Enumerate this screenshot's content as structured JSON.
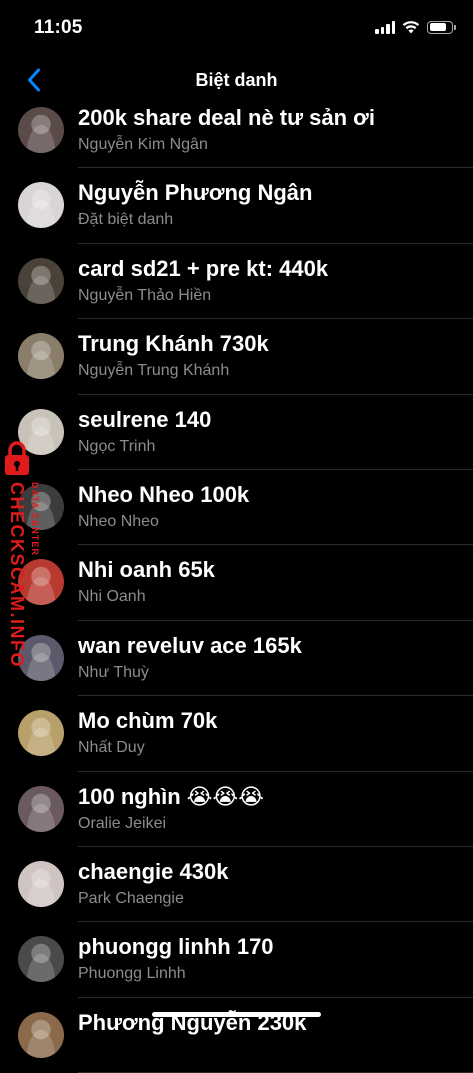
{
  "status_bar": {
    "time": "11:05",
    "battery_level": 0.8
  },
  "nav": {
    "title": "Biệt danh",
    "back_icon": "chevron-left-icon",
    "accent": "#0a84ff"
  },
  "watermark": {
    "main": "CHECKSCAM.INFO",
    "sub": "DATA CENTER",
    "color": "#e01b1b"
  },
  "contacts": [
    {
      "nickname": "200k share deal nè tư sản ơi",
      "name": "Nguyễn Kim Ngân",
      "avatar_color": "#5a4a48"
    },
    {
      "nickname": "Nguyễn Phương Ngân",
      "name": "Đặt biệt danh",
      "avatar_color": "#d9d4d6"
    },
    {
      "nickname": "card sd21 + pre kt: 440k",
      "name": "Nguyễn Thảo Hiền",
      "avatar_color": "#4a4238"
    },
    {
      "nickname": "Trung Khánh 730k",
      "name": "Nguyễn Trung Khánh",
      "avatar_color": "#8a7e6a"
    },
    {
      "nickname": "seulrene 140",
      "name": "Ngọc Trinh",
      "avatar_color": "#c9c2b8"
    },
    {
      "nickname": "Nheo Nheo 100k",
      "name": "Nheo Nheo",
      "avatar_color": "#3c3c3c"
    },
    {
      "nickname": "Nhi oanh 65k",
      "name": "Nhi Oanh",
      "avatar_color": "#b83a2e"
    },
    {
      "nickname": "wan reveluv ace 165k",
      "name": "Như Thuỳ",
      "avatar_color": "#5a5a6a"
    },
    {
      "nickname": "Mo chùm 70k",
      "name": "Nhất Duy",
      "avatar_color": "#b8a06a"
    },
    {
      "nickname": "100 nghìn 😭😭😭",
      "name": "Oralie Jeikei",
      "avatar_color": "#6a5a5e"
    },
    {
      "nickname": "chaengie 430k",
      "name": "Park Chaengie",
      "avatar_color": "#cfc4c2"
    },
    {
      "nickname": "phuongg linhh 170",
      "name": "Phuongg Linhh",
      "avatar_color": "#4a4a4a"
    },
    {
      "nickname": "Phương Nguyễn 230k",
      "name": "",
      "avatar_color": "#8a6a4a"
    }
  ]
}
